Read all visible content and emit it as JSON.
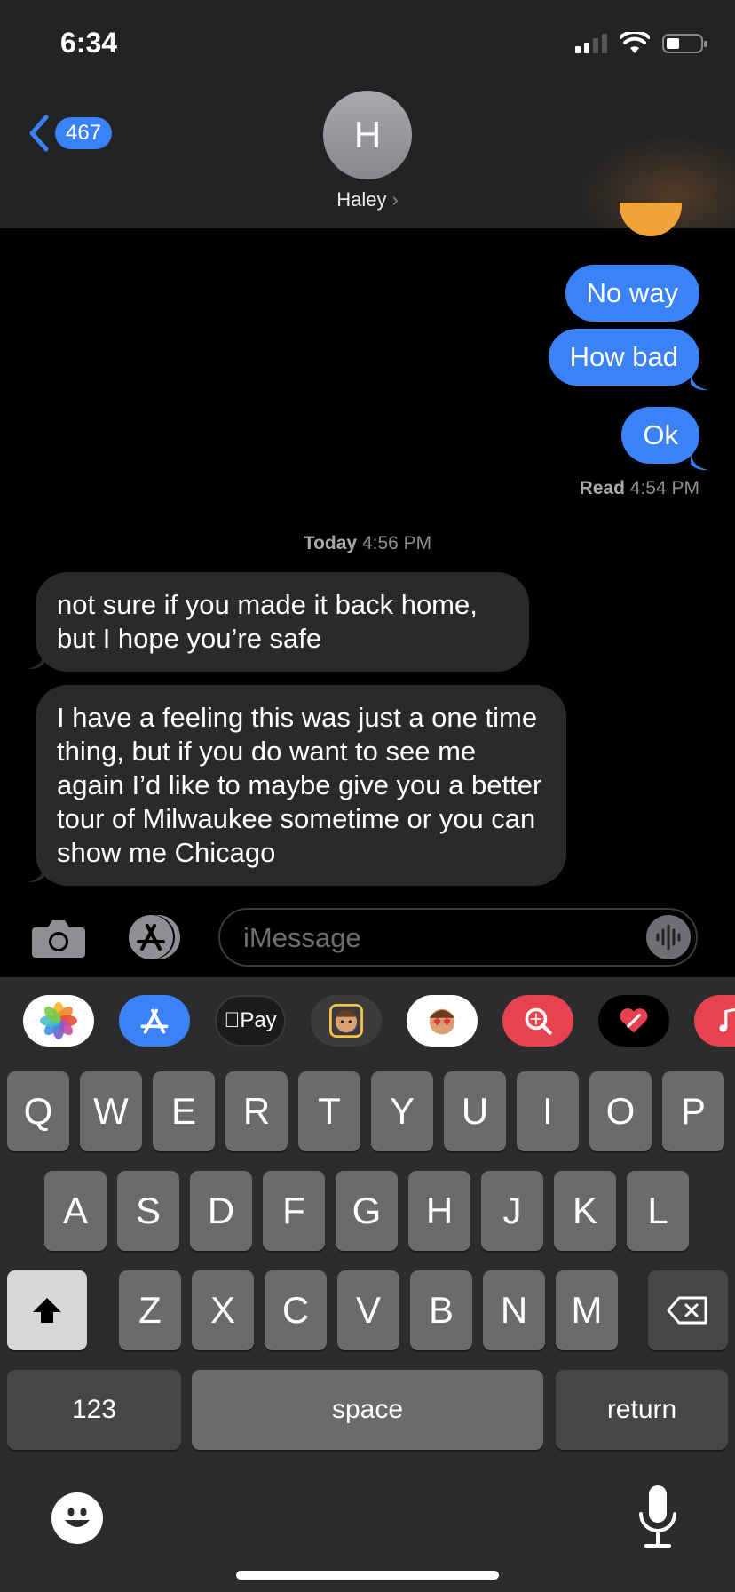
{
  "status_bar": {
    "time": "6:34"
  },
  "header": {
    "back_count": "467",
    "avatar_initial": "H",
    "contact_name": "Haley",
    "contact_chevron": "›"
  },
  "messages": {
    "sent": [
      "No way",
      "How bad",
      "Ok"
    ],
    "read_label": "Read",
    "read_time": "4:54 PM",
    "day_label": "Today",
    "day_time": "4:56 PM",
    "received": [
      "not sure if you made it back home, but I hope you’re safe",
      "I have a feeling this was just a one time thing, but if you do want to see me again I’d like to maybe give you a better tour of Milwaukee sometime or you can show me Chicago"
    ]
  },
  "input": {
    "placeholder": "iMessage"
  },
  "app_drawer": {
    "apps": [
      "photos-app-icon",
      "app-store-icon",
      "apple-pay-icon",
      "memoji-icon",
      "memoji-stickers-icon",
      "web-images-icon",
      "digital-touch-icon",
      "music-icon"
    ],
    "apple_pay_label": "Pay"
  },
  "keyboard": {
    "row1": [
      "Q",
      "W",
      "E",
      "R",
      "T",
      "Y",
      "U",
      "I",
      "O",
      "P"
    ],
    "row2": [
      "A",
      "S",
      "D",
      "F",
      "G",
      "H",
      "J",
      "K",
      "L"
    ],
    "row3": [
      "Z",
      "X",
      "C",
      "V",
      "B",
      "N",
      "M"
    ],
    "numbers_label": "123",
    "space_label": "space",
    "return_label": "return"
  },
  "colors": {
    "sent_bubble": "#3b82f6",
    "received_bubble": "#2a2a2c",
    "accent": "#3a82f7"
  }
}
